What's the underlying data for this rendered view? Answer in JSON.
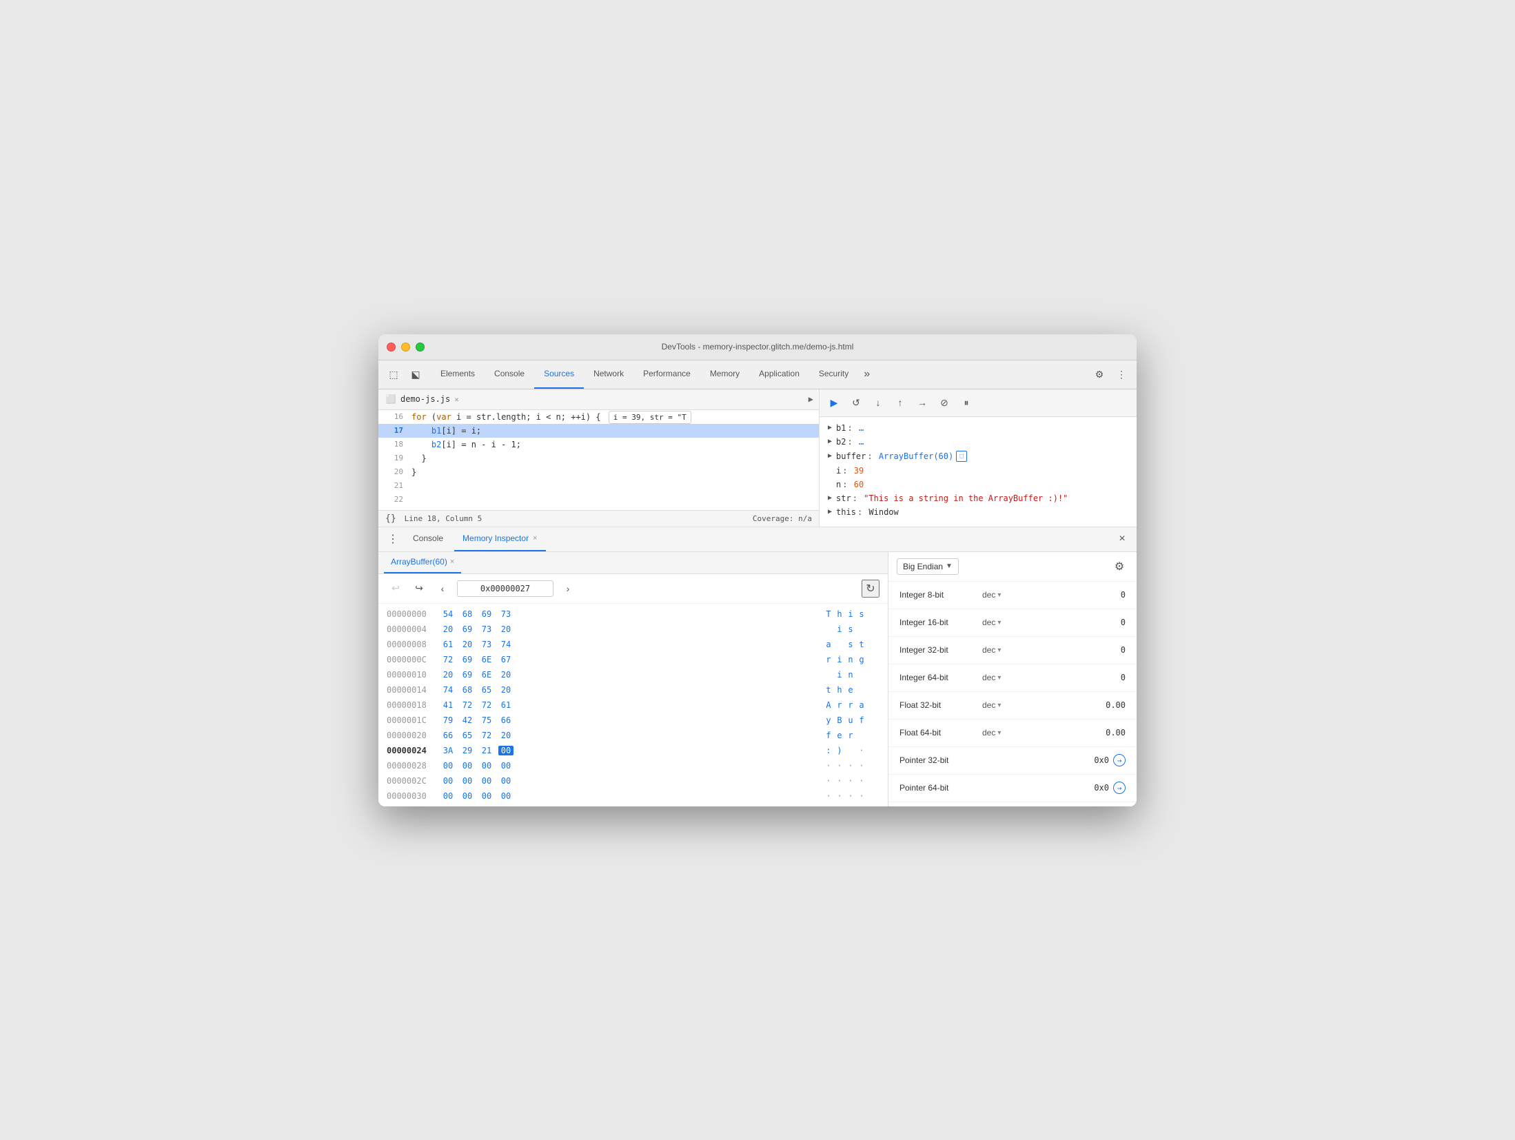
{
  "window": {
    "title": "DevTools - memory-inspector.glitch.me/demo-js.html"
  },
  "titlebar": {
    "traffic": [
      "red",
      "yellow",
      "green"
    ]
  },
  "nav": {
    "tabs": [
      {
        "label": "Elements",
        "active": false
      },
      {
        "label": "Console",
        "active": false
      },
      {
        "label": "Sources",
        "active": true
      },
      {
        "label": "Network",
        "active": false
      },
      {
        "label": "Performance",
        "active": false
      },
      {
        "label": "Memory",
        "active": false
      },
      {
        "label": "Application",
        "active": false
      },
      {
        "label": "Security",
        "active": false
      }
    ],
    "more_label": "»"
  },
  "source": {
    "file_name": "demo-js.js",
    "lines": [
      {
        "num": "16",
        "text": "    for (var i = str.length; i < n; ++i) {",
        "tooltip": "i = 39, str = \"T",
        "has_tooltip": true,
        "active": false,
        "highlighted": false
      },
      {
        "num": "17",
        "text": "        b1[i] = i;",
        "has_tooltip": false,
        "active": true,
        "highlighted": false
      },
      {
        "num": "18",
        "text": "        b2[i] = n - i - 1;",
        "has_tooltip": false,
        "active": false,
        "highlighted": false
      },
      {
        "num": "19",
        "text": "    }",
        "has_tooltip": false,
        "active": false
      },
      {
        "num": "20",
        "text": "}",
        "has_tooltip": false,
        "active": false
      },
      {
        "num": "21",
        "text": "",
        "has_tooltip": false,
        "active": false
      },
      {
        "num": "22",
        "text": "",
        "has_tooltip": false,
        "active": false
      }
    ],
    "status": {
      "position": "Line 18, Column 5",
      "coverage": "Coverage: n/a"
    }
  },
  "scope": {
    "items": [
      {
        "key": "b1",
        "colon": ":",
        "val": "…",
        "type": "ref"
      },
      {
        "key": "b2",
        "colon": ":",
        "val": "…",
        "type": "ref"
      },
      {
        "key": "buffer",
        "colon": ":",
        "val": "ArrayBuffer(60)",
        "type": "buffer",
        "has_mem_icon": true
      },
      {
        "key": "i",
        "colon": ":",
        "val": "39",
        "type": "num"
      },
      {
        "key": "n",
        "colon": ":",
        "val": "60",
        "type": "num"
      },
      {
        "key": "str",
        "colon": ":",
        "val": "\"This is a string in the ArrayBuffer :)!\"",
        "type": "string"
      },
      {
        "key": "this",
        "colon": ":",
        "val": "Window",
        "type": "ref"
      }
    ]
  },
  "panel_tabs": {
    "console_label": "Console",
    "memory_inspector_label": "Memory Inspector",
    "close_icon": "×"
  },
  "memory_inspector": {
    "buffer_tab_label": "ArrayBuffer(60)",
    "address_value": "0x00000027",
    "rows": [
      {
        "addr": "00000000",
        "bytes": [
          "54",
          "68",
          "69",
          "73"
        ],
        "chars": [
          "T",
          "h",
          "i",
          "s"
        ],
        "selected": false
      },
      {
        "addr": "00000004",
        "bytes": [
          "20",
          "69",
          "73",
          "20"
        ],
        "chars": [
          " ",
          "i",
          "s",
          " "
        ],
        "selected": false
      },
      {
        "addr": "00000008",
        "bytes": [
          "61",
          "20",
          "73",
          "74"
        ],
        "chars": [
          "a",
          " ",
          "s",
          "t"
        ],
        "selected": false
      },
      {
        "addr": "0000000C",
        "bytes": [
          "72",
          "69",
          "6E",
          "67"
        ],
        "chars": [
          "r",
          "i",
          "n",
          "g"
        ],
        "selected": false
      },
      {
        "addr": "00000010",
        "bytes": [
          "20",
          "69",
          "6E",
          "20"
        ],
        "chars": [
          " ",
          "i",
          "n",
          " "
        ],
        "selected": false
      },
      {
        "addr": "00000014",
        "bytes": [
          "74",
          "68",
          "65",
          "20"
        ],
        "chars": [
          "t",
          "h",
          "e",
          " "
        ],
        "selected": false
      },
      {
        "addr": "00000018",
        "bytes": [
          "41",
          "72",
          "72",
          "61"
        ],
        "chars": [
          "A",
          "r",
          "r",
          "a"
        ],
        "selected": false
      },
      {
        "addr": "0000001C",
        "bytes": [
          "79",
          "42",
          "75",
          "66"
        ],
        "chars": [
          "y",
          "B",
          "u",
          "f"
        ],
        "selected": false
      },
      {
        "addr": "00000020",
        "bytes": [
          "66",
          "65",
          "72",
          "20"
        ],
        "chars": [
          "f",
          "e",
          "r",
          " "
        ],
        "selected": false
      },
      {
        "addr": "00000024",
        "bytes": [
          "3A",
          "29",
          "21",
          "00"
        ],
        "chars": [
          ":",
          ")",
          " ",
          "·"
        ],
        "selected": true,
        "selected_byte_idx": 3
      },
      {
        "addr": "00000028",
        "bytes": [
          "00",
          "00",
          "00",
          "00"
        ],
        "chars": [
          "·",
          "·",
          "·",
          "·"
        ],
        "selected": false
      },
      {
        "addr": "0000002C",
        "bytes": [
          "00",
          "00",
          "00",
          "00"
        ],
        "chars": [
          "·",
          "·",
          "·",
          "·"
        ],
        "selected": false
      },
      {
        "addr": "00000030",
        "bytes": [
          "00",
          "00",
          "00",
          "00"
        ],
        "chars": [
          "·",
          "·",
          "·",
          "·"
        ],
        "selected": false
      }
    ]
  },
  "value_inspector": {
    "endian_label": "Big Endian",
    "rows": [
      {
        "type": "Integer 8-bit",
        "format": "dec",
        "value": "0"
      },
      {
        "type": "Integer 16-bit",
        "format": "dec",
        "value": "0"
      },
      {
        "type": "Integer 32-bit",
        "format": "dec",
        "value": "0"
      },
      {
        "type": "Integer 64-bit",
        "format": "dec",
        "value": "0"
      },
      {
        "type": "Float 32-bit",
        "format": "dec",
        "value": "0.00"
      },
      {
        "type": "Float 64-bit",
        "format": "dec",
        "value": "0.00"
      },
      {
        "type": "Pointer 32-bit",
        "format": "",
        "value": "0x0",
        "has_pointer": true
      },
      {
        "type": "Pointer 64-bit",
        "format": "",
        "value": "0x0",
        "has_pointer": true
      }
    ]
  }
}
